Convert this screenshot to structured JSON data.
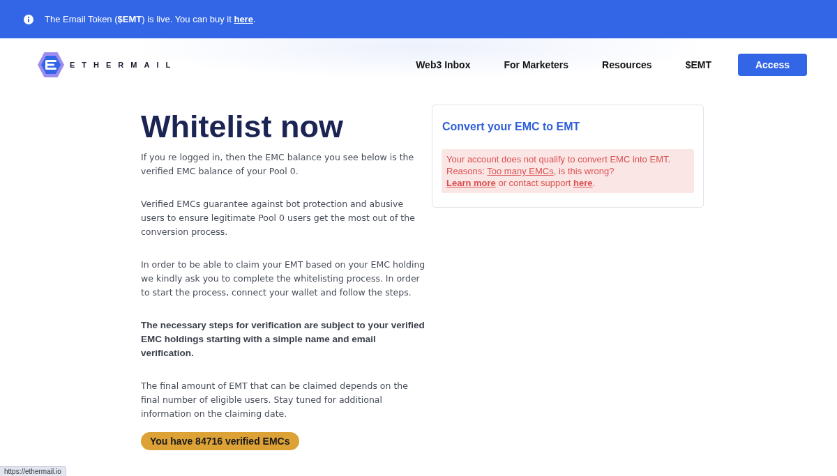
{
  "banner": {
    "before": "The Email Token (**$EMT**) is live. You can buy it ",
    "link": "here",
    "after": "."
  },
  "header": {
    "logo_text": "ETHERMAIL",
    "nav": [
      "Web3 Inbox",
      "For Marketers",
      "Resources",
      "$EMT"
    ],
    "access_button": "Access"
  },
  "whitelist": {
    "title": "Whitelist now",
    "paragraphs": [
      {
        "text": "If you re logged in, then the EMC balance you see below is the verified EMC balance of your Pool 0.",
        "bold": false
      },
      {
        "text": "Verified EMCs guarantee against bot protection and abusive users to ensure legitimate Pool 0 users get the most out of the conversion process.",
        "bold": false
      },
      {
        "text": "In order to be able to claim your EMT based on your EMC holding we kindly ask you to complete the whitelisting process. In order to start the process, connect your wallet and follow the steps.",
        "bold": false
      },
      {
        "text": "The necessary steps for verification are subject to your verified EMC holdings starting with a simple name and email verification.",
        "bold": true
      },
      {
        "text": "The final amount of EMT that can be claimed depends on the final number of eligible users. Stay tuned for additional information on the claiming date.",
        "bold": false
      }
    ],
    "balance": "You have 84716 verified EMCs"
  },
  "convert_card": {
    "title": "Convert your EMC to EMT",
    "alert_lines": [
      {
        "segments": [
          {
            "kind": "text",
            "text": "Your account does not qualify to convert EMC into EMT."
          }
        ]
      },
      {
        "segments": [
          {
            "kind": "text",
            "text": "Reasons: "
          },
          {
            "kind": "link",
            "text": "Too many EMCs"
          },
          {
            "kind": "text",
            "text": ", is this wrong?"
          }
        ]
      },
      {
        "segments": [
          {
            "kind": "strong_link",
            "text": "Learn more"
          },
          {
            "kind": "text",
            "text": " or contact support "
          },
          {
            "kind": "strong_link",
            "text": "here"
          },
          {
            "kind": "text",
            "text": "."
          }
        ]
      }
    ]
  },
  "status_url": "https://ethermail.io"
}
